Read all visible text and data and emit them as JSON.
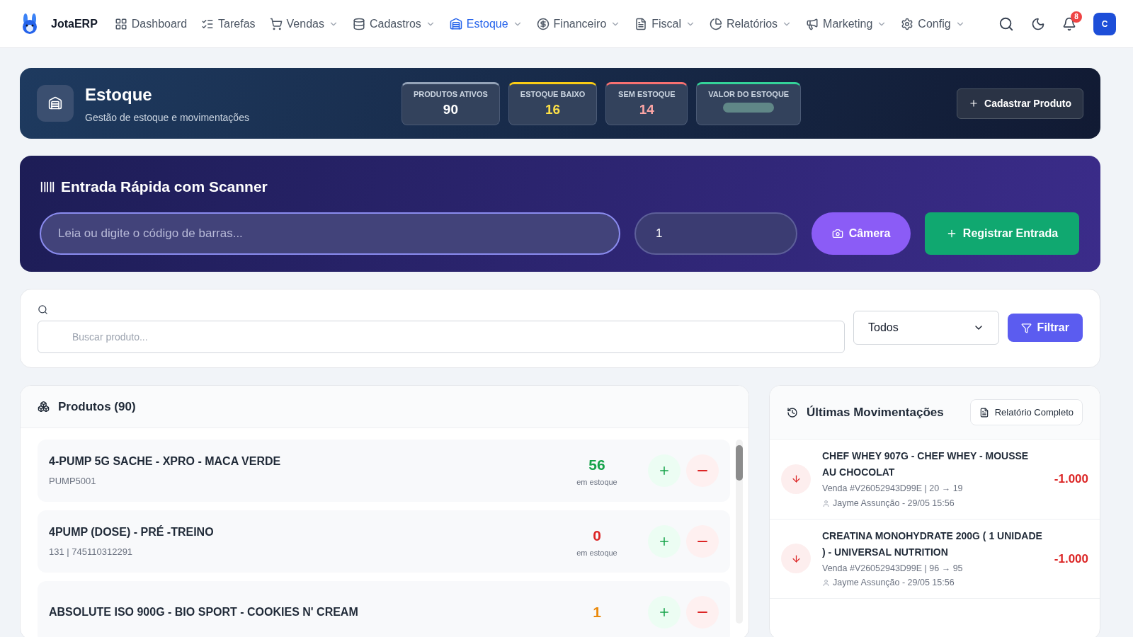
{
  "nav": {
    "brand": "JotaERP",
    "items": [
      {
        "label": "Dashboard",
        "dropdown": false,
        "selected": false
      },
      {
        "label": "Tarefas",
        "dropdown": false,
        "selected": false
      },
      {
        "label": "Vendas",
        "dropdown": true,
        "selected": false
      },
      {
        "label": "Cadastros",
        "dropdown": true,
        "selected": false
      },
      {
        "label": "Estoque",
        "dropdown": true,
        "selected": true
      },
      {
        "label": "Financeiro",
        "dropdown": true,
        "selected": false
      },
      {
        "label": "Fiscal",
        "dropdown": true,
        "selected": false
      },
      {
        "label": "Relatórios",
        "dropdown": true,
        "selected": false
      },
      {
        "label": "Marketing",
        "dropdown": true,
        "selected": false
      },
      {
        "label": "Config",
        "dropdown": true,
        "selected": false
      }
    ],
    "notification_count": "8",
    "avatar": "C"
  },
  "header": {
    "title": "Estoque",
    "subtitle": "Gestão de estoque e movimentações",
    "stats": [
      {
        "label": "PRODUTOS ATIVOS",
        "value": "90",
        "color": "#94a3b8"
      },
      {
        "label": "ESTOQUE BAIXO",
        "value": "16",
        "color": "#facc15"
      },
      {
        "label": "SEM ESTOQUE",
        "value": "14",
        "color": "#f87171"
      },
      {
        "label": "VALOR DO ESTOQUE",
        "blurred": true,
        "color": "#34d399"
      }
    ],
    "button": "Cadastrar Produto"
  },
  "scanner": {
    "title": "Entrada Rápida com Scanner",
    "placeholder": "Leia ou digite o código de barras...",
    "quantity": "1",
    "camera_button": "Câmera",
    "register_button": "Registrar Entrada"
  },
  "filter": {
    "placeholder": "Buscar produto...",
    "select": "Todos",
    "button": "Filtrar"
  },
  "products": {
    "title": "Produtos (90)",
    "items": [
      {
        "name": "4-PUMP 5G SACHE - XPRO - MACA VERDE",
        "code": "PUMP5001",
        "stock": "56",
        "stock_label": "em estoque",
        "color": "#16a34a"
      },
      {
        "name": "4PUMP (DOSE) - PRÉ -TREINO",
        "code": "131 | 745110312291",
        "stock": "0",
        "stock_label": "em estoque",
        "color": "#dc2626"
      },
      {
        "name": "ABSOLUTE ISO 900G - BIO SPORT - COOKIES N' CREAM",
        "stock": "1",
        "color": "#ea8a0c"
      }
    ]
  },
  "movements": {
    "title": "Últimas Movimentações",
    "button": "Relatório Completo",
    "items": [
      {
        "product": "CHEF WHEY 907G - CHEF WHEY - MOUSSE AU CHOCOLAT",
        "detail": "Venda #V26052943D99E | 20 → 19",
        "user": "Jayme Assunção - 29/05 15:56",
        "quantity": "-1.000"
      },
      {
        "product": "CREATINA MONOHYDRATE 200G ( 1 UNIDADE ) - UNIVERSAL NUTRITION",
        "detail": "Venda #V26052943D99E | 96 → 95",
        "user": "Jayme Assunção - 29/05 15:56",
        "quantity": "-1.000"
      }
    ]
  }
}
